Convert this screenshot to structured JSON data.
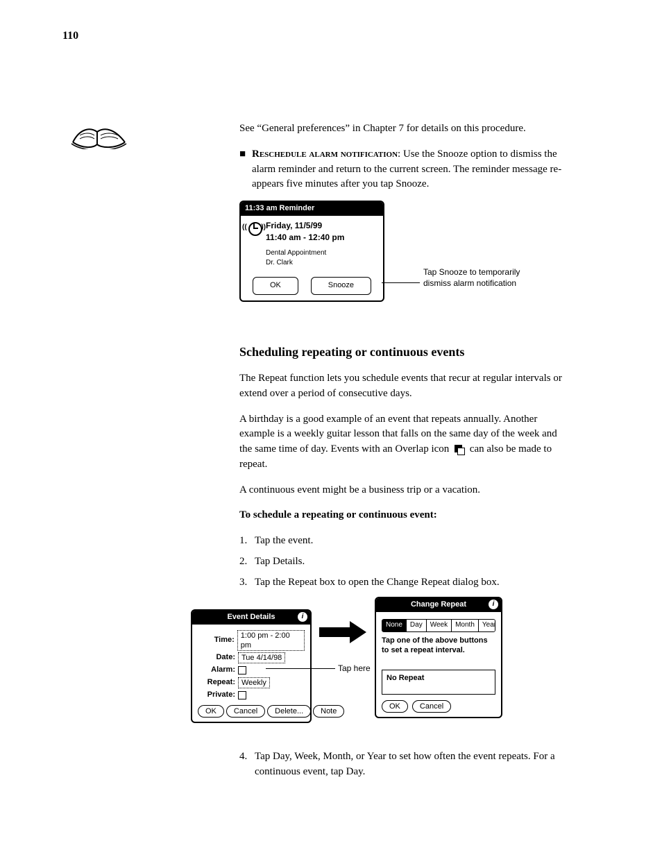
{
  "page_number": "110",
  "para1": "See “General preferences” in Chapter 7 for details on this procedure.",
  "bullet_alarm_label": "Reschedule alarm notification",
  "bullet_alarm_body": ": Use the Snooze option to dismiss the alarm reminder and return to the current screen. The reminder message re-appears five minutes after you tap Snooze.",
  "reminder": {
    "titlebar": "11:33 am   Reminder",
    "date_line": "Friday, 11/5/99",
    "time_line": "11:40 am - 12:40 pm",
    "desc1": "Dental Appointment",
    "desc2": "Dr. Clark",
    "ok": "OK",
    "snooze": "Snooze"
  },
  "reminder_annot": "Tap Snooze to temporarily dismiss alarm notification",
  "heading_repeat": "Scheduling repeating or continuous events",
  "para_repeat1": "The Repeat function lets you schedule events that recur at regular intervals or extend over a period of consecutive days.",
  "para_repeat2_a": "A birthday is a good example of an event that repeats annually. Another example is a weekly guitar lesson that falls on the same day of the week and the same time of day. Events with an Overlap icon ",
  "para_repeat2_b": " can also be made to repeat.",
  "para_repeat3": "A continuous event might be a business trip or a vacation.",
  "subheading": "To schedule a repeating or continuous event:",
  "step1": "Tap the event.",
  "step2": "Tap Details.",
  "step3": "Tap the Repeat box to open the Change Repeat dialog box.",
  "event_details": {
    "title": "Event Details",
    "time_label": "Time:",
    "time_value": "1:00 pm - 2:00 pm",
    "date_label": "Date:",
    "date_value": "Tue 4/14/98",
    "alarm_label": "Alarm:",
    "repeat_label": "Repeat:",
    "repeat_value": "Weekly",
    "private_label": "Private:",
    "ok": "OK",
    "cancel": "Cancel",
    "delete": "Delete...",
    "note": "Note"
  },
  "event_details_annot": "Tap here",
  "change_repeat": {
    "title": "Change Repeat",
    "tabs": [
      "None",
      "Day",
      "Week",
      "Month",
      "Year"
    ],
    "instruction": "Tap one of the above buttons to set a repeat interval.",
    "status": "No Repeat",
    "ok": "OK",
    "cancel": "Cancel"
  },
  "step4": "Tap Day, Week, Month, or Year to set how often the event repeats. For a continuous event, tap Day."
}
